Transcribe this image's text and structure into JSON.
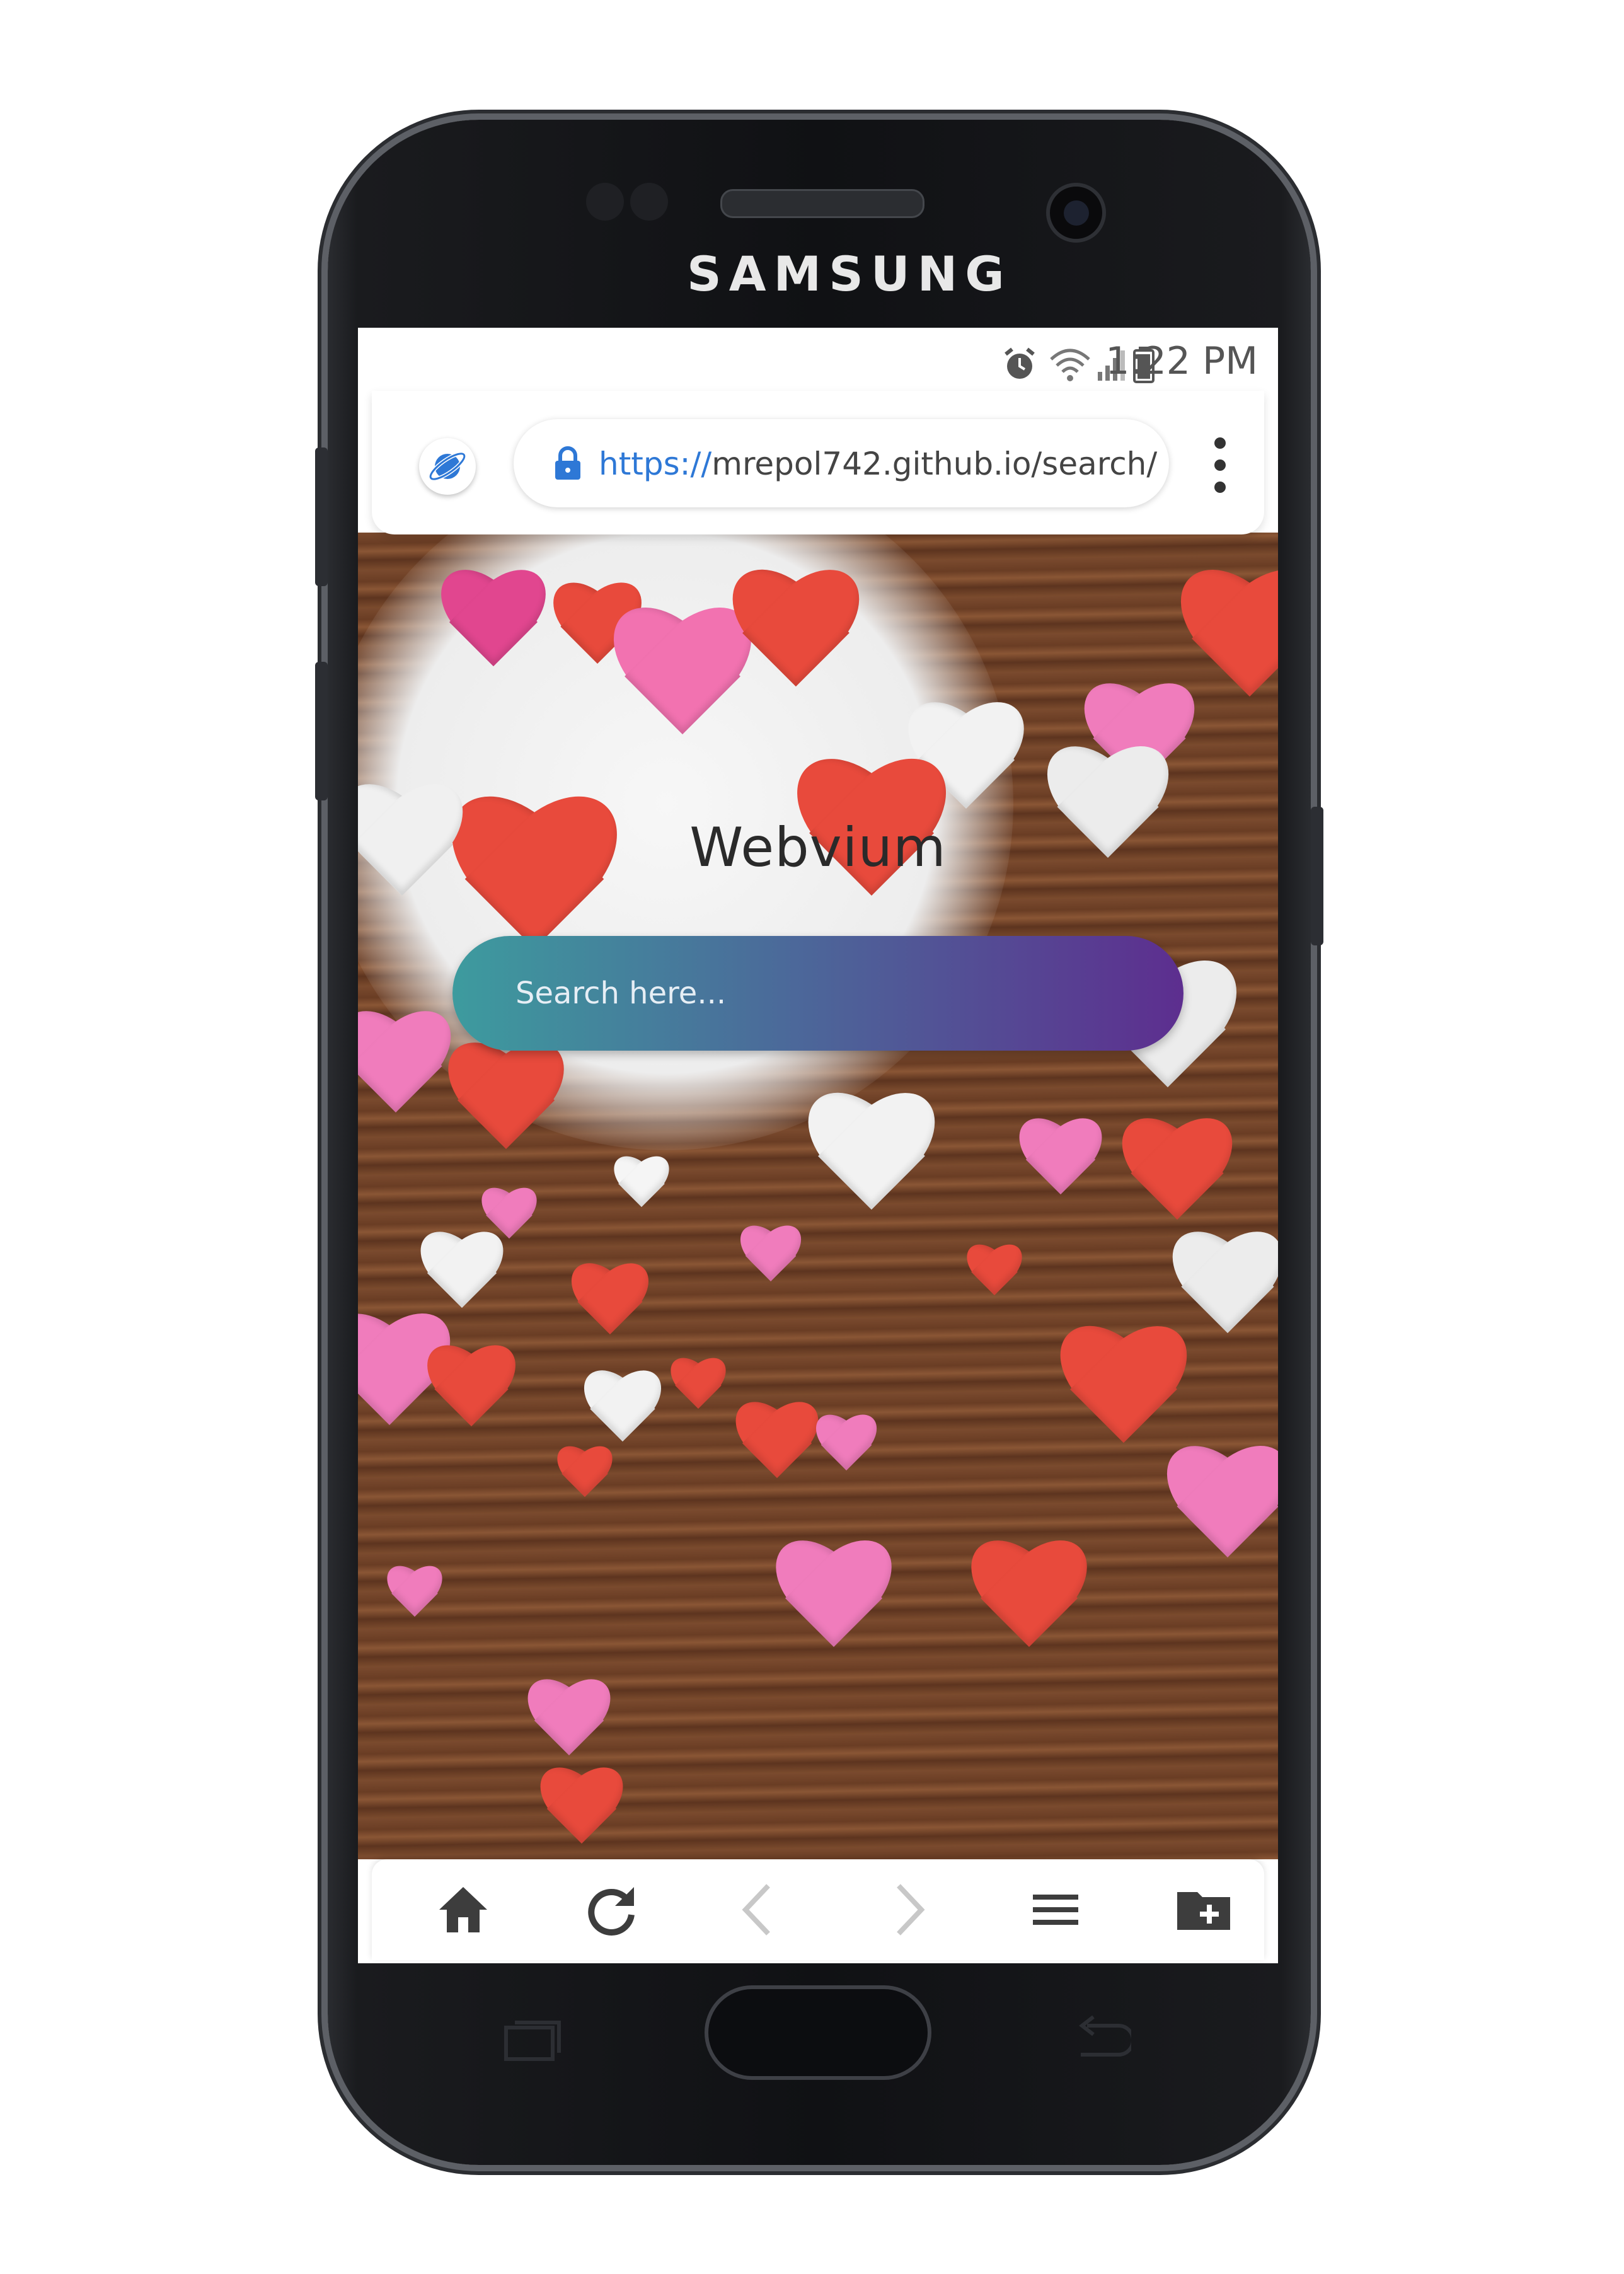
{
  "device": {
    "brand": "SAMSUNG"
  },
  "status_bar": {
    "time": "1:22 PM",
    "icons": [
      "alarm-icon",
      "wifi-icon",
      "signal-icon",
      "battery-icon"
    ]
  },
  "address_bar": {
    "url_scheme": "https://",
    "url_rest": "mrepol742.github.io/search/",
    "icons": [
      "webvium-logo-icon",
      "lock-icon",
      "more-vert-icon"
    ]
  },
  "page": {
    "title": "Webvium",
    "search": {
      "placeholder": "Search here...",
      "value": ""
    }
  },
  "bottom_nav": {
    "items": [
      "home-icon",
      "reload-icon",
      "back-icon",
      "forward-icon",
      "menu-icon",
      "add-bookmark-folder-icon"
    ]
  },
  "colors": {
    "accent_blue": "#2e78d6",
    "search_gradient_start": "#3d9b9e",
    "search_gradient_end": "#5d2e8f",
    "disabled_icon": "#c8c8c8",
    "icon_dark": "#3d3d3d"
  }
}
